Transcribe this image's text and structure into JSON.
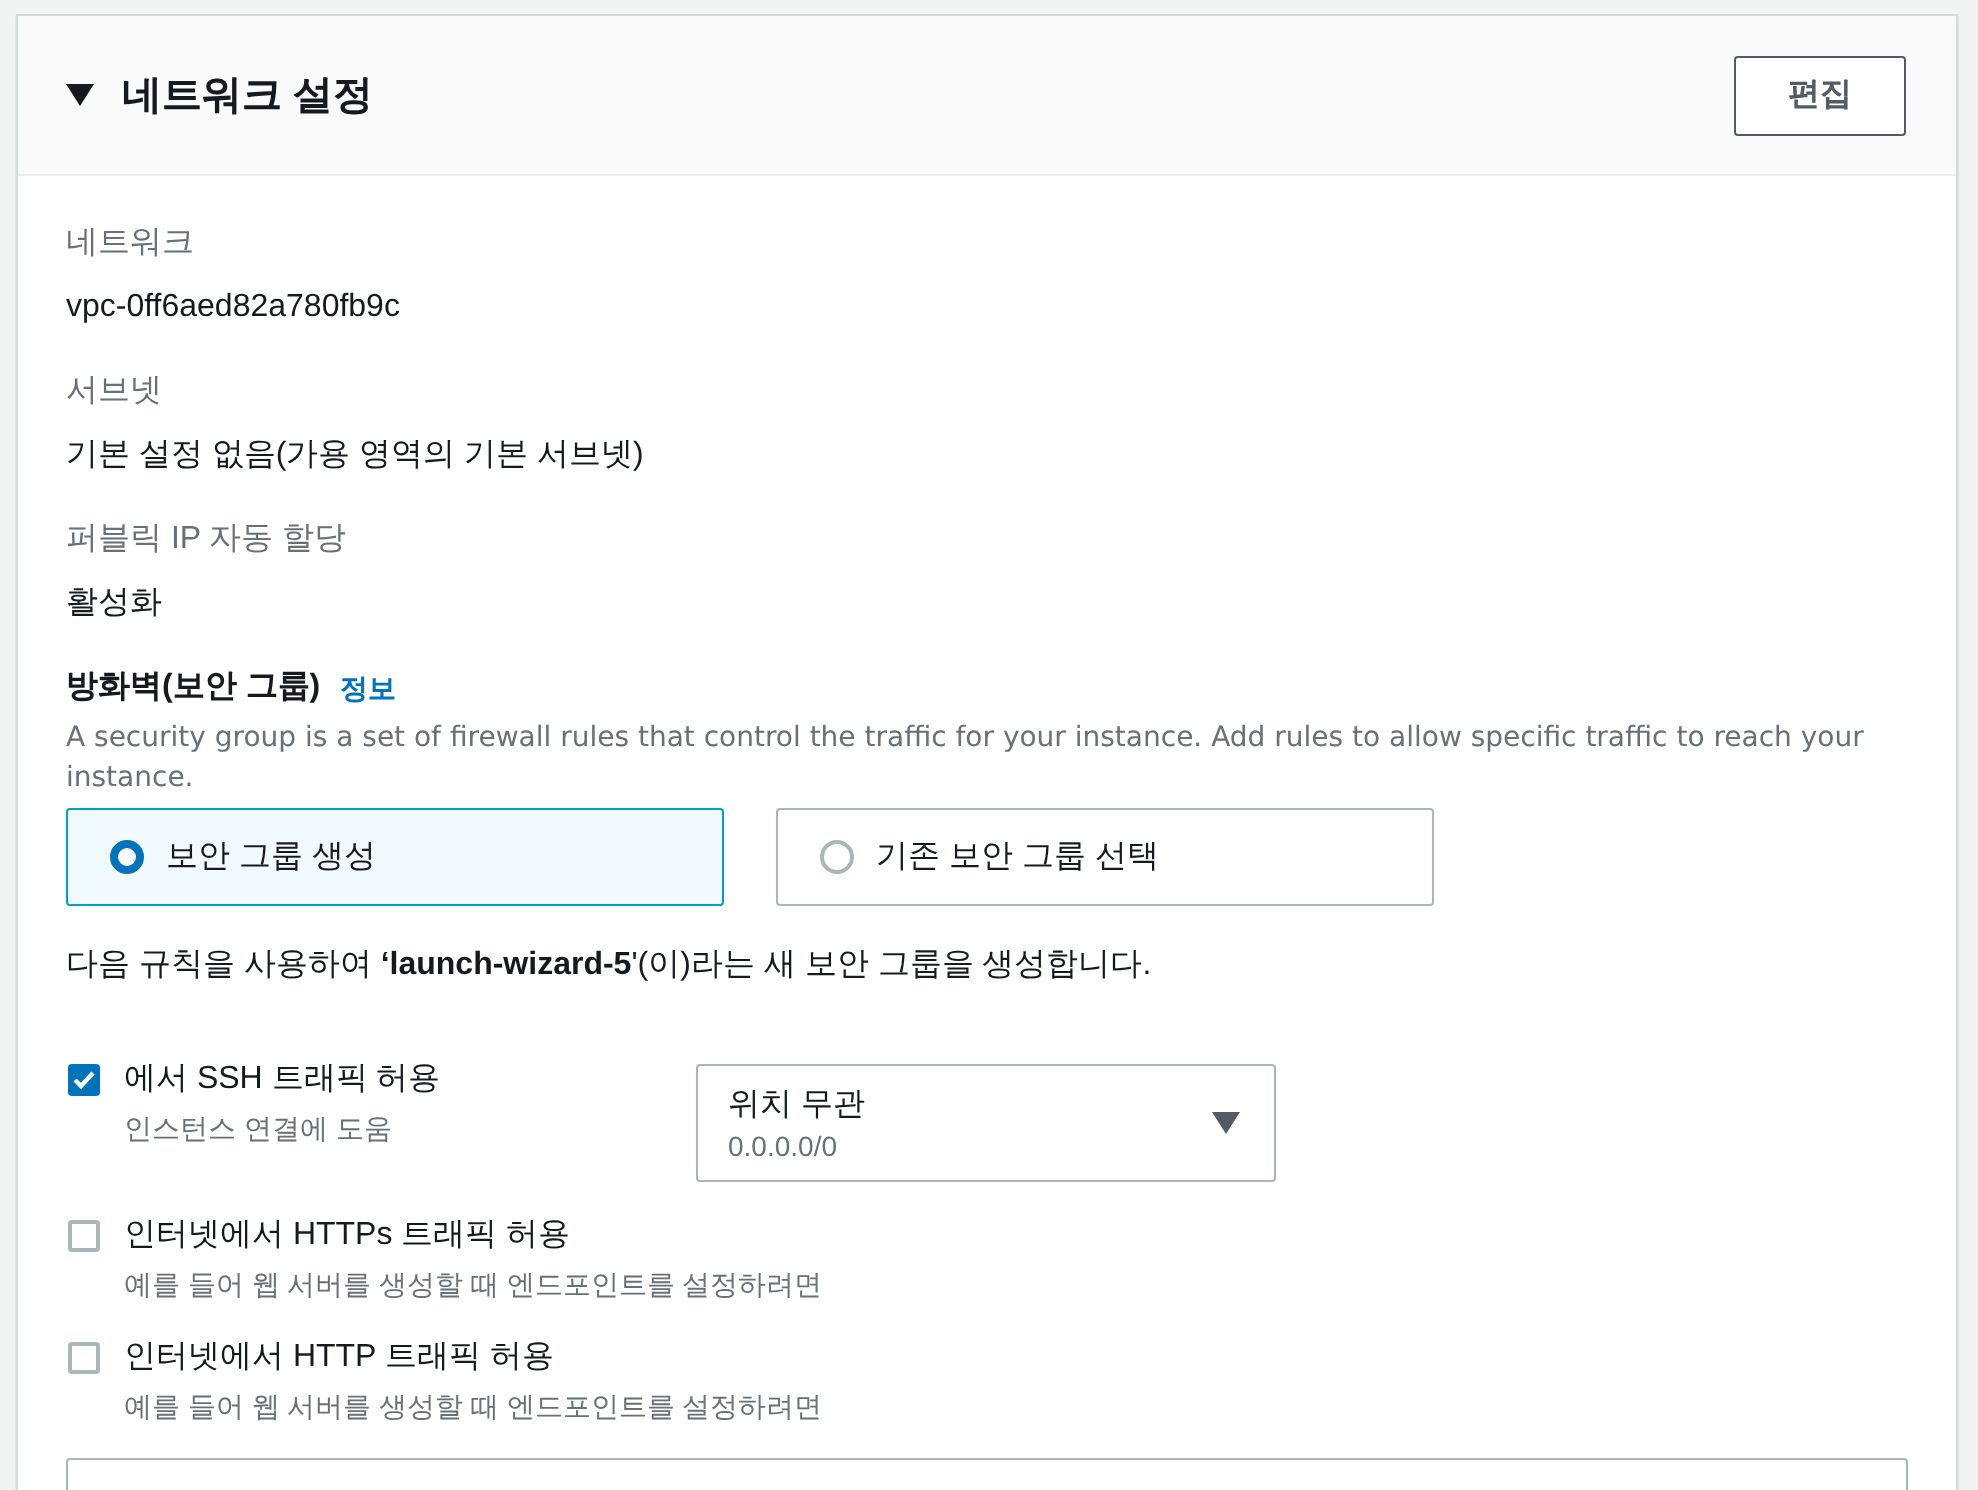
{
  "panel": {
    "title": "네트워크 설정",
    "expanded": true,
    "edit_button": "편집"
  },
  "fields": [
    {
      "label": "네트워크",
      "value": "vpc-0ff6aed82a780fb9c"
    },
    {
      "label": "서브넷",
      "value": "기본 설정 없음(가용 영역의 기본 서브넷)"
    },
    {
      "label": "퍼블릭 IP 자동 할당",
      "value": "활성화"
    }
  ],
  "firewall": {
    "title": "방화벽(보안 그룹)",
    "info_link": "정보",
    "description": "A security group is a set of firewall rules that control the traffic for your instance. Add rules to allow specific traffic to reach your instance.",
    "options": [
      {
        "label": "보안 그룹 생성",
        "selected": true
      },
      {
        "label": "기존 보안 그룹 선택",
        "selected": false
      }
    ],
    "note": "다음 규칙을 사용하여 **‘launch-wizard-5**'(이)라는 새 보안 그룹을 생성합니다.",
    "rules": [
      {
        "label": "에서 SSH 트래픽 허용",
        "hint": "인스턴스 연결에 도움",
        "checked": true,
        "source": {
          "value": "위치 무관",
          "detail": "0.0.0.0/0"
        }
      },
      {
        "label": "인터넷에서 HTTPs 트래픽 허용",
        "hint": "예를 들어 웹 서버를 생성할 때 엔드포인트를 설정하려면",
        "checked": false
      },
      {
        "label": "인터넷에서 HTTP 트래픽 허용",
        "hint": "예를 들어 웹 서버를 생성할 때 엔드포인트를 설정하려면",
        "checked": false
      }
    ]
  }
}
